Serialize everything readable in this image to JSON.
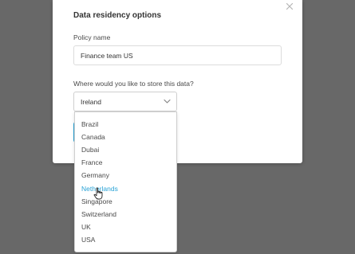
{
  "modal": {
    "title": "Data residency options",
    "close_icon": "close-icon"
  },
  "policy_name": {
    "label": "Policy name",
    "value": "Finance team US"
  },
  "storage": {
    "label": "Where would you like to store this data?",
    "selected": "Ireland",
    "icon": "chevron-down-icon",
    "options": [
      "Brazil",
      "Canada",
      "Dubai",
      "France",
      "Germany",
      "Netherlands",
      "Singapore",
      "Switzerland",
      "UK",
      "USA"
    ],
    "hovered_option": "Netherlands"
  },
  "colors": {
    "overlay": "#686868",
    "accent": "#2aa3d6",
    "text": "#4a4a4a",
    "border": "#cfcfcf"
  },
  "cursor_icon": "pointer-hand-icon"
}
